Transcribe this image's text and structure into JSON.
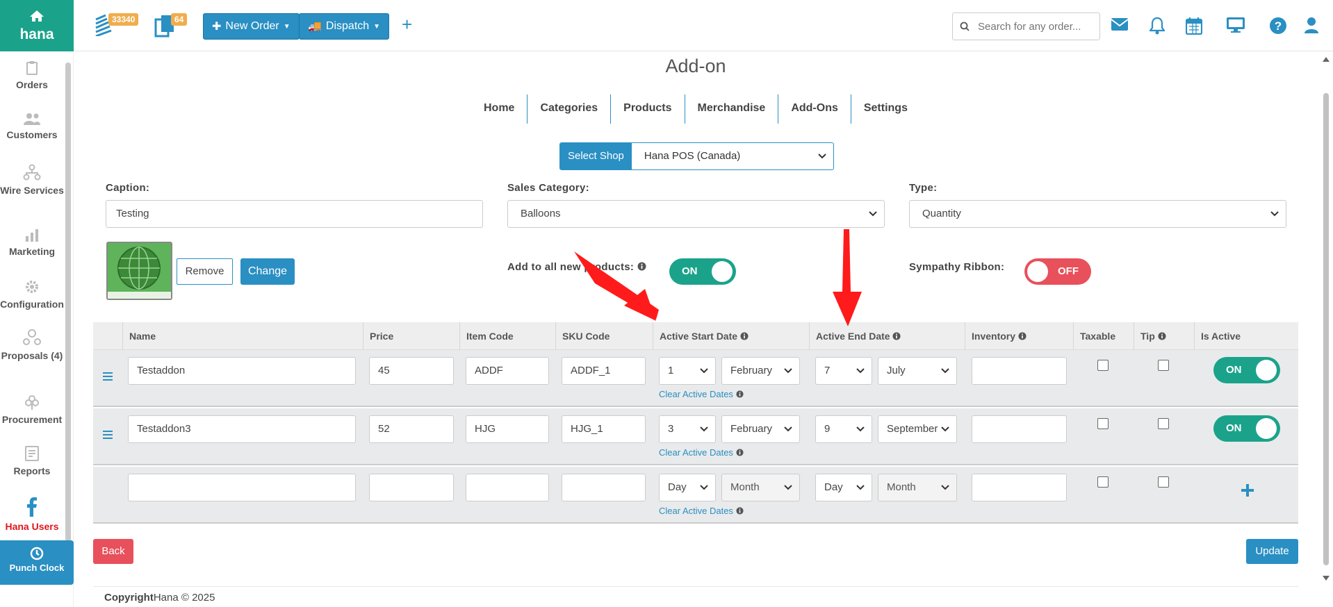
{
  "topbar": {
    "brand": "hana",
    "orders_badge": "33340",
    "copies_badge": "64",
    "new_order_label": "New Order",
    "dispatch_label": "Dispatch",
    "search_placeholder": "Search for any order..."
  },
  "sidebar": {
    "items": [
      {
        "label": "Orders"
      },
      {
        "label": "Customers"
      },
      {
        "label": "Wire Services"
      },
      {
        "label": "Marketing"
      },
      {
        "label": "Configuration"
      },
      {
        "label": "Proposals (4)"
      },
      {
        "label": "Procurement"
      },
      {
        "label": "Reports"
      },
      {
        "label": "Hana Users"
      }
    ],
    "punch_clock": "Punch Clock"
  },
  "page": {
    "title": "Add-on",
    "tabs": [
      "Home",
      "Categories",
      "Products",
      "Merchandise",
      "Add-Ons",
      "Settings"
    ],
    "select_shop_label": "Select Shop",
    "shop_value": "Hana POS (Canada)"
  },
  "form": {
    "caption_label": "Caption:",
    "caption_value": "Testing",
    "sales_category_label": "Sales Category:",
    "sales_category_value": "Balloons",
    "type_label": "Type:",
    "type_value": "Quantity",
    "remove_label": "Remove",
    "change_label": "Change",
    "add_all_label": "Add to all new products:",
    "add_all_state": "ON",
    "sympathy_label": "Sympathy Ribbon:",
    "sympathy_state": "OFF"
  },
  "table": {
    "headers": [
      "Name",
      "Price",
      "Item Code",
      "SKU Code",
      "Active Start Date",
      "Active End Date",
      "Inventory",
      "Taxable",
      "Tip",
      "Is Active"
    ],
    "clear_label": "Clear Active Dates",
    "rows": [
      {
        "name": "Testaddon",
        "price": "45",
        "item_code": "ADDF",
        "sku": "ADDF_1",
        "start_day": "1",
        "start_month": "February",
        "end_day": "7",
        "end_month": "July",
        "inventory": "",
        "active": "ON"
      },
      {
        "name": "Testaddon3",
        "price": "52",
        "item_code": "HJG",
        "sku": "HJG_1",
        "start_day": "3",
        "start_month": "February",
        "end_day": "9",
        "end_month": "September",
        "inventory": "",
        "active": "ON"
      },
      {
        "name": "",
        "price": "",
        "item_code": "",
        "sku": "",
        "start_day": "Day",
        "start_month": "Month",
        "end_day": "Day",
        "end_month": "Month",
        "inventory": "",
        "active": ""
      }
    ]
  },
  "actions": {
    "back_label": "Back",
    "update_label": "Update"
  },
  "footer": {
    "copyright_bold": "Copyright",
    "copyright_rest": "Hana © 2025"
  },
  "colors": {
    "brand": "#1aa38a",
    "primary": "#2a8fc3",
    "danger": "#e8505b",
    "annotation_arrow": "#ff0000"
  }
}
